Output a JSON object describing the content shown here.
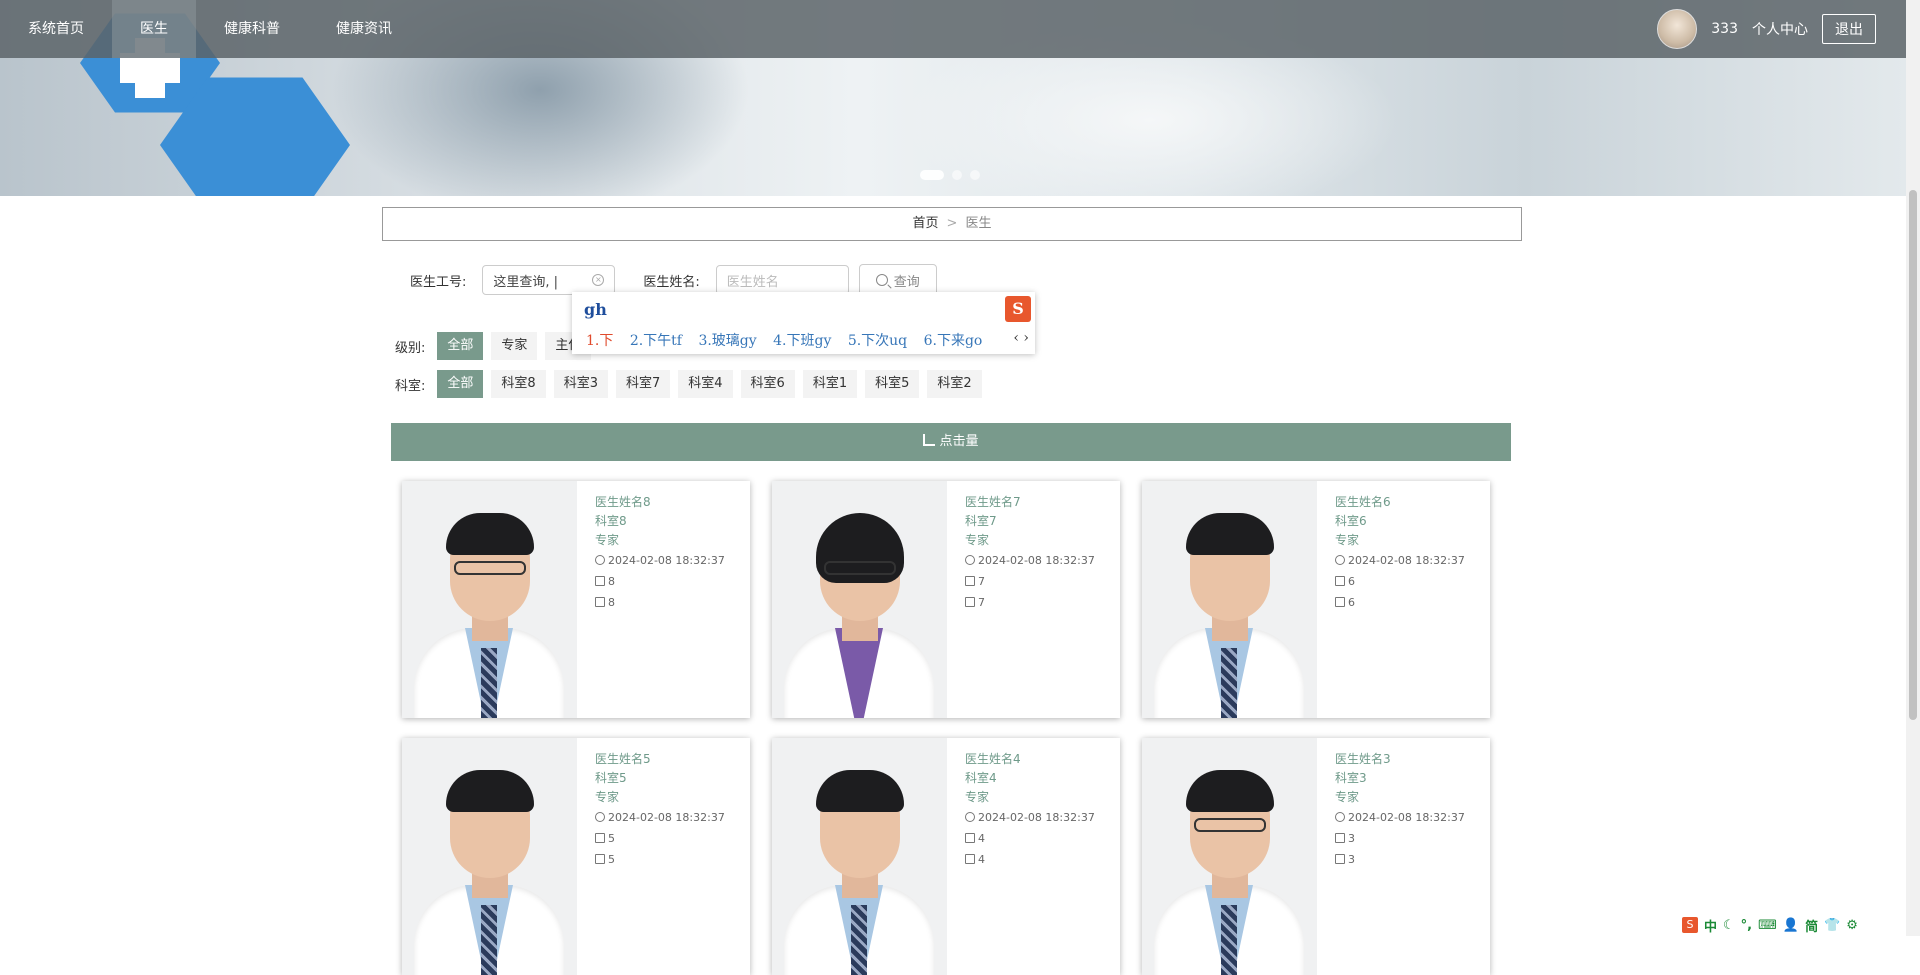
{
  "nav": {
    "items": [
      "系统首页",
      "医生",
      "健康科普",
      "健康资讯"
    ],
    "active_index": 1,
    "username": "333",
    "profile_label": "个人中心",
    "logout_label": "退出"
  },
  "breadcrumb": {
    "home": "首页",
    "separator": ">",
    "current": "医生"
  },
  "search": {
    "id_label": "医生工号:",
    "id_value": "这里查询, |",
    "name_label": "医生姓名:",
    "name_placeholder": "医生姓名",
    "button_label": "查询"
  },
  "ime_popup": {
    "composition": "gh",
    "candidates": [
      "1.下",
      "2.下午tf",
      "3.玻璃gy",
      "4.下班gy",
      "5.下次uq",
      "6.下来go"
    ],
    "nav_arrows": "‹ ›"
  },
  "filters": {
    "level_label": "级别:",
    "levels": [
      "全部",
      "专家",
      "主任"
    ],
    "level_active": 0,
    "dept_label": "科室:",
    "depts": [
      "全部",
      "科室8",
      "科室3",
      "科室7",
      "科室4",
      "科室6",
      "科室1",
      "科室5",
      "科室2"
    ],
    "dept_active": 0
  },
  "section": {
    "title": "点击量"
  },
  "doctors": [
    {
      "name": "医生姓名8",
      "dept": "科室8",
      "level": "专家",
      "time": "2024-02-08 18:32:37",
      "likes": "8",
      "comments": "8",
      "gender": "male"
    },
    {
      "name": "医生姓名7",
      "dept": "科室7",
      "level": "专家",
      "time": "2024-02-08 18:32:37",
      "likes": "7",
      "comments": "7",
      "gender": "female"
    },
    {
      "name": "医生姓名6",
      "dept": "科室6",
      "level": "专家",
      "time": "2024-02-08 18:32:37",
      "likes": "6",
      "comments": "6",
      "gender": "male"
    },
    {
      "name": "医生姓名5",
      "dept": "科室5",
      "level": "专家",
      "time": "2024-02-08 18:32:37",
      "likes": "5",
      "comments": "5",
      "gender": "male"
    },
    {
      "name": "医生姓名4",
      "dept": "科室4",
      "level": "专家",
      "time": "2024-02-08 18:32:37",
      "likes": "4",
      "comments": "4",
      "gender": "male"
    },
    {
      "name": "医生姓名3",
      "dept": "科室3",
      "level": "专家",
      "time": "2024-02-08 18:32:37",
      "likes": "3",
      "comments": "3",
      "gender": "male"
    }
  ],
  "ime_bar": {
    "logo": "S",
    "items": [
      "中",
      "☾",
      "°,",
      "⌨",
      "👤",
      "简",
      "👕",
      "⚙"
    ]
  },
  "colors": {
    "accent": "#799a8c",
    "link_text": "#6f9a8a",
    "ime_orange": "#e8572d"
  }
}
